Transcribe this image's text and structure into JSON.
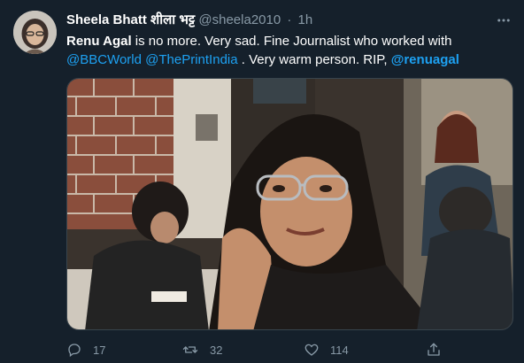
{
  "tweet": {
    "author": {
      "display_name": "Sheela Bhatt शीला भट्ट",
      "handle": "@sheela2010",
      "separator": "·",
      "timestamp": "1h"
    },
    "text": {
      "lead_name": "Renu Agal",
      "line1_rest": " is no more. Very sad. Fine Journalist who worked with",
      "mention1": "@BBCWorld",
      "mention2": "@ThePrintIndia",
      "line2_rest": " . Very warm person. RIP, ",
      "mention3": "@renuagal"
    },
    "actions": {
      "reply_count": "17",
      "retweet_count": "32",
      "like_count": "114"
    },
    "icons": {
      "more": "more-icon",
      "reply": "reply-icon",
      "retweet": "retweet-icon",
      "like": "heart-icon",
      "share": "share-icon"
    },
    "colors": {
      "background": "#15202b",
      "text": "#ffffff",
      "secondary": "#8899a6",
      "link": "#1da1f2"
    }
  }
}
